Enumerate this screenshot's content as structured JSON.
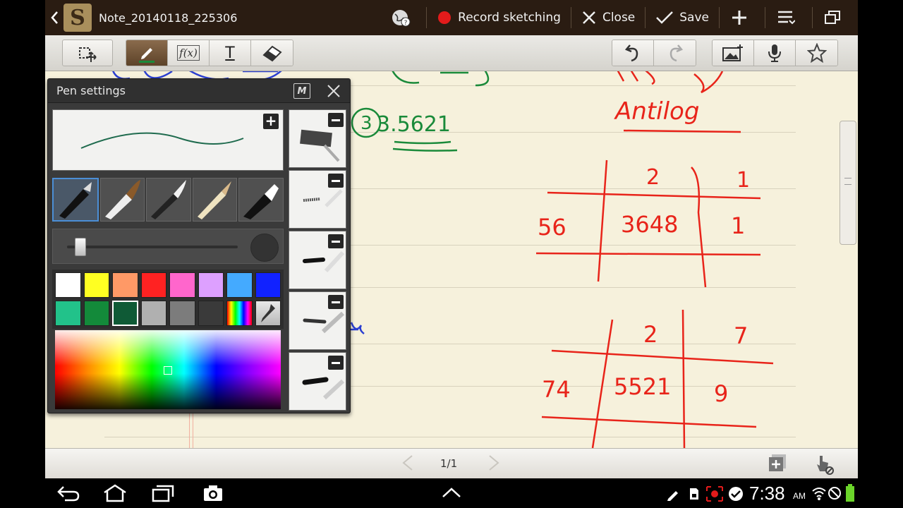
{
  "titlebar": {
    "note_title": "Note_20140118_225306",
    "app_logo_letter": "S",
    "record_label": "Record sketching",
    "close_label": "Close",
    "save_label": "Save"
  },
  "toolbar": {
    "text_tool_glyph": "T",
    "formula_tool_glyph": "f(x)"
  },
  "pen_panel": {
    "title": "Pen settings",
    "mode_icon_label": "M",
    "preview_stroke_color": "#1f6b4e",
    "colors": [
      "#ffffff",
      "#ffff22",
      "#ff9966",
      "#ff2222",
      "#ff66cc",
      "#dda0ff",
      "#44aaff",
      "#1122ff",
      "#22c28a",
      "#138a3a",
      "#0f5a36",
      "#b0b0b0",
      "#7c7c7c",
      "#3a3a3a",
      "rainbow",
      "picker"
    ],
    "selected_color_index": 10,
    "size_level": 0.05
  },
  "bottombar": {
    "page_indicator": "1/1"
  },
  "notes": {
    "row1_value": "3.5621",
    "heading": "Antilog",
    "table1": {
      "col_a": "2",
      "col_b": "1",
      "row_label": "56",
      "cell_a": "3648",
      "cell_b": "1"
    },
    "table2": {
      "col_a": "2",
      "col_b": "7",
      "row_label": "74",
      "cell_a": "5521",
      "cell_b": "9"
    }
  },
  "status": {
    "time": "7:38",
    "ampm": "AM"
  },
  "colors": {
    "accent_brown": "#5d4329",
    "title_bg": "#2a1c12",
    "paper": "#f6f1dc",
    "ink_red": "#e8241a",
    "ink_green": "#1a8a3a"
  }
}
